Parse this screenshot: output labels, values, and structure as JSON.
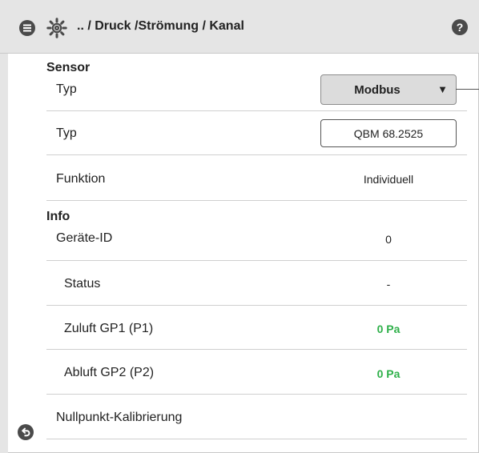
{
  "header": {
    "breadcrumb": ".. / Druck /Strömung / Kanal",
    "help_label": "?"
  },
  "sensor": {
    "section_title": "Sensor",
    "rows": [
      {
        "label": "Typ",
        "value": "Modbus",
        "arrow": "▼"
      },
      {
        "label": "Typ",
        "value": "QBM 68.2525"
      },
      {
        "label": "Funktion",
        "value": "Individuell"
      }
    ]
  },
  "info": {
    "section_title": "Info",
    "rows": [
      {
        "label": "Geräte-ID",
        "value": "0"
      },
      {
        "label": "Status",
        "value": "-"
      },
      {
        "label": "Zuluft GP1 (P1)",
        "value": "0 Pa"
      },
      {
        "label": "Abluft GP2 (P2)",
        "value": "0 Pa"
      }
    ]
  },
  "calibration": {
    "label": "Nullpunkt-Kalibrierung"
  },
  "colors": {
    "accent_green": "#2fb04a",
    "header_bg": "#e5e5e5",
    "icon_dark": "#4a4a4a"
  },
  "icons": [
    "menu-icon",
    "gear-icon",
    "help-icon",
    "chevron-down-icon",
    "back-icon"
  ]
}
